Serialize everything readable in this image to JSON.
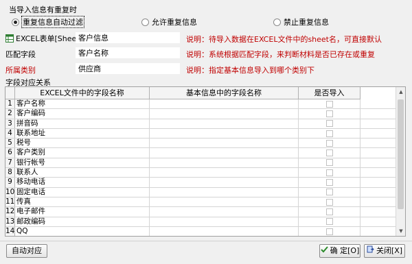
{
  "duplicate": {
    "title": "当导入信息有重复时",
    "options": [
      {
        "label": "重复信息自动过滤",
        "checked": true
      },
      {
        "label": "允许重复信息",
        "checked": false
      },
      {
        "label": "禁止重复信息",
        "checked": false
      }
    ]
  },
  "form": {
    "sheet": {
      "label": "EXCEL表单[Sheet名]",
      "value": "客户信息",
      "note": "说明：待导入数据在EXCEL文件中的sheet名，可直接默认"
    },
    "match": {
      "label": "匹配字段",
      "value": "客户名称",
      "note": "说明：系统根据匹配字段，来判断材料是否已存在或重复"
    },
    "category": {
      "label": "所属类别",
      "value": "供应商",
      "note": "说明：指定基本信息导入到哪个类别下"
    }
  },
  "mapping": {
    "section_label": "字段对应关系",
    "columns": [
      "EXCEL文件中的字段名称",
      "基本信息中的字段名称",
      "是否导入"
    ],
    "rows": [
      {
        "n": "1",
        "excel": "客户名称",
        "base": "",
        "import": false
      },
      {
        "n": "2",
        "excel": "客户编码",
        "base": "",
        "import": false
      },
      {
        "n": "3",
        "excel": "拼音码",
        "base": "",
        "import": false
      },
      {
        "n": "4",
        "excel": "联系地址",
        "base": "",
        "import": false
      },
      {
        "n": "5",
        "excel": "税号",
        "base": "",
        "import": false
      },
      {
        "n": "6",
        "excel": "客户类别",
        "base": "",
        "import": false
      },
      {
        "n": "7",
        "excel": "银行帐号",
        "base": "",
        "import": false
      },
      {
        "n": "8",
        "excel": "联系人",
        "base": "",
        "import": false
      },
      {
        "n": "9",
        "excel": "移动电话",
        "base": "",
        "import": false
      },
      {
        "n": "10",
        "excel": "固定电话",
        "base": "",
        "import": false
      },
      {
        "n": "11",
        "excel": "传真",
        "base": "",
        "import": false
      },
      {
        "n": "12",
        "excel": "电子邮件",
        "base": "",
        "import": false
      },
      {
        "n": "13",
        "excel": "邮政编码",
        "base": "",
        "import": false
      },
      {
        "n": "14",
        "excel": "QQ",
        "base": "",
        "import": false
      }
    ]
  },
  "buttons": {
    "auto": "自动对应",
    "ok": "确 定[O]",
    "close": "关闭[X]"
  },
  "colors": {
    "note": "#c00000",
    "ok_icon": "#2a8a2a",
    "close_icon": "#2a4a9a"
  }
}
